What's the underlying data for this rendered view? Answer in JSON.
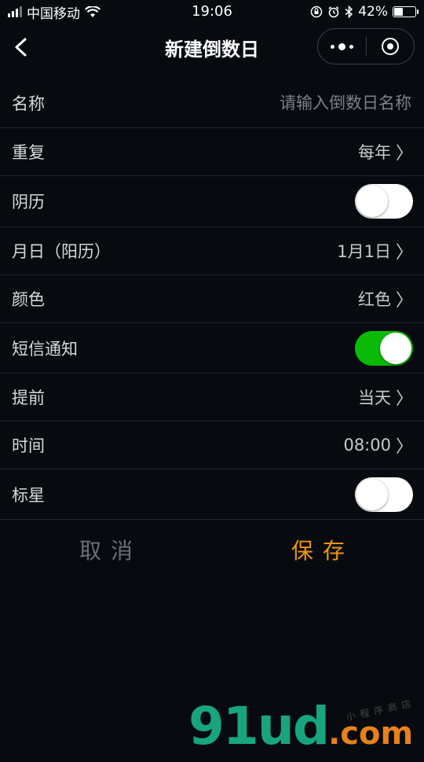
{
  "status_bar": {
    "carrier": "中国移动",
    "time": "19:06",
    "battery": "42%",
    "battery_level": 0.42
  },
  "nav": {
    "title": "新建倒数日"
  },
  "form": {
    "name": {
      "label": "名称",
      "placeholder": "请输入倒数日名称",
      "value": ""
    },
    "repeat": {
      "label": "重复",
      "value": "每年"
    },
    "lunar": {
      "label": "阴历",
      "on": false
    },
    "date": {
      "label": "月日（阳历）",
      "value": "1月1日"
    },
    "color": {
      "label": "颜色",
      "value": "红色"
    },
    "sms": {
      "label": "短信通知",
      "on": true
    },
    "advance": {
      "label": "提前",
      "value": "当天"
    },
    "time": {
      "label": "时间",
      "value": "08:00"
    },
    "star": {
      "label": "标星",
      "on": false
    }
  },
  "actions": {
    "cancel": "取消",
    "save": "保存"
  },
  "colors": {
    "background": "#070b10",
    "toggle_on": "#09bb07",
    "save": "#f0960a",
    "cancel": "#6b6f75"
  },
  "watermark": {
    "brand_main": "91ud",
    "brand_tld": ".com",
    "tagline": "小程序商店"
  }
}
